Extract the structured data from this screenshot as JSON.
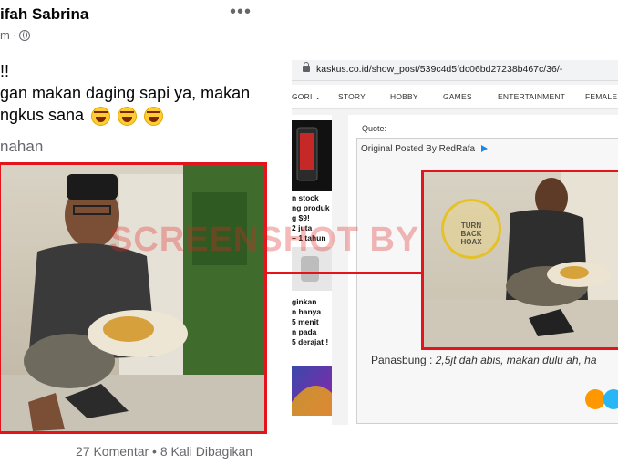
{
  "facebook_post": {
    "author_name": "ifah Sabrina",
    "time": "m",
    "more_menu": "•••",
    "text_lines": [
      "!!",
      "gan makan daging sapi ya, makan",
      "ngkus sana"
    ],
    "emoji_count": 3,
    "tagged_line": "nahan",
    "stats": "27 Komentar • 8 Kali Dibagikan"
  },
  "browser": {
    "url": "kaskus.co.id/show_post/539c4d5fdc06bd27238b467c/36/-"
  },
  "kaskus": {
    "nav": [
      "GORI ⌄",
      "STORY",
      "HOBBY",
      "GAMES",
      "ENTERTAINMENT",
      "FEMALE"
    ],
    "sidebar_article_1": [
      "n stock",
      "ng produk",
      "g $9!",
      "2 juta",
      "+ 1 tahun"
    ],
    "sidebar_article_2": [
      "ginkan",
      "n hanya",
      "5 menit",
      "n pada",
      "5 derajat !"
    ],
    "quote_label": "Quote:",
    "original_posted_by": "Original Posted By",
    "poster": "RedRafa",
    "caption_name": "Panasbung :",
    "caption_text": "2,5jt dah abis, makan dulu ah, ha",
    "hoax_badge": [
      "TURN",
      "BACK",
      "HOAX"
    ]
  },
  "watermark": "SCREENSHOT BY",
  "colors": {
    "highlight_red": "#e3141b",
    "link_blue": "#1e88e5"
  }
}
